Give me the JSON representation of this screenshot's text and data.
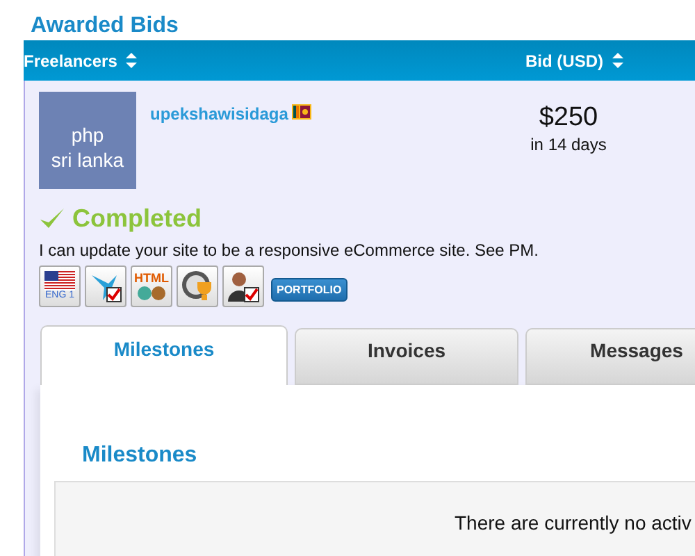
{
  "section_title": "Awarded Bids",
  "table": {
    "columns": [
      {
        "label": "Freelancers",
        "sortable": true
      },
      {
        "label": "Bid (USD)",
        "sortable": true
      }
    ],
    "bid": {
      "avatar_lines": [
        "php",
        "sri lanka"
      ],
      "username": "upekshawisidaga",
      "amount": "$250",
      "duration": "in 14 days",
      "status": {
        "kind": "completed",
        "label": "Completed"
      },
      "proposal": "I can update your site to be a responsive eCommerce site. See PM.",
      "badges": [
        {
          "kind": "language",
          "text": "ENG 1"
        },
        {
          "kind": "bird"
        },
        {
          "kind": "html",
          "text": "HTML"
        },
        {
          "kind": "wordpress"
        },
        {
          "kind": "person"
        }
      ],
      "portfolio_button": "PORTFOLIO"
    }
  },
  "tabs": [
    {
      "label": "Milestones",
      "selected": true
    },
    {
      "label": "Invoices",
      "selected": false
    },
    {
      "label": "Messages",
      "selected": false
    }
  ],
  "milestones": {
    "title": "Milestones",
    "empty_message": "There are currently no activ"
  }
}
